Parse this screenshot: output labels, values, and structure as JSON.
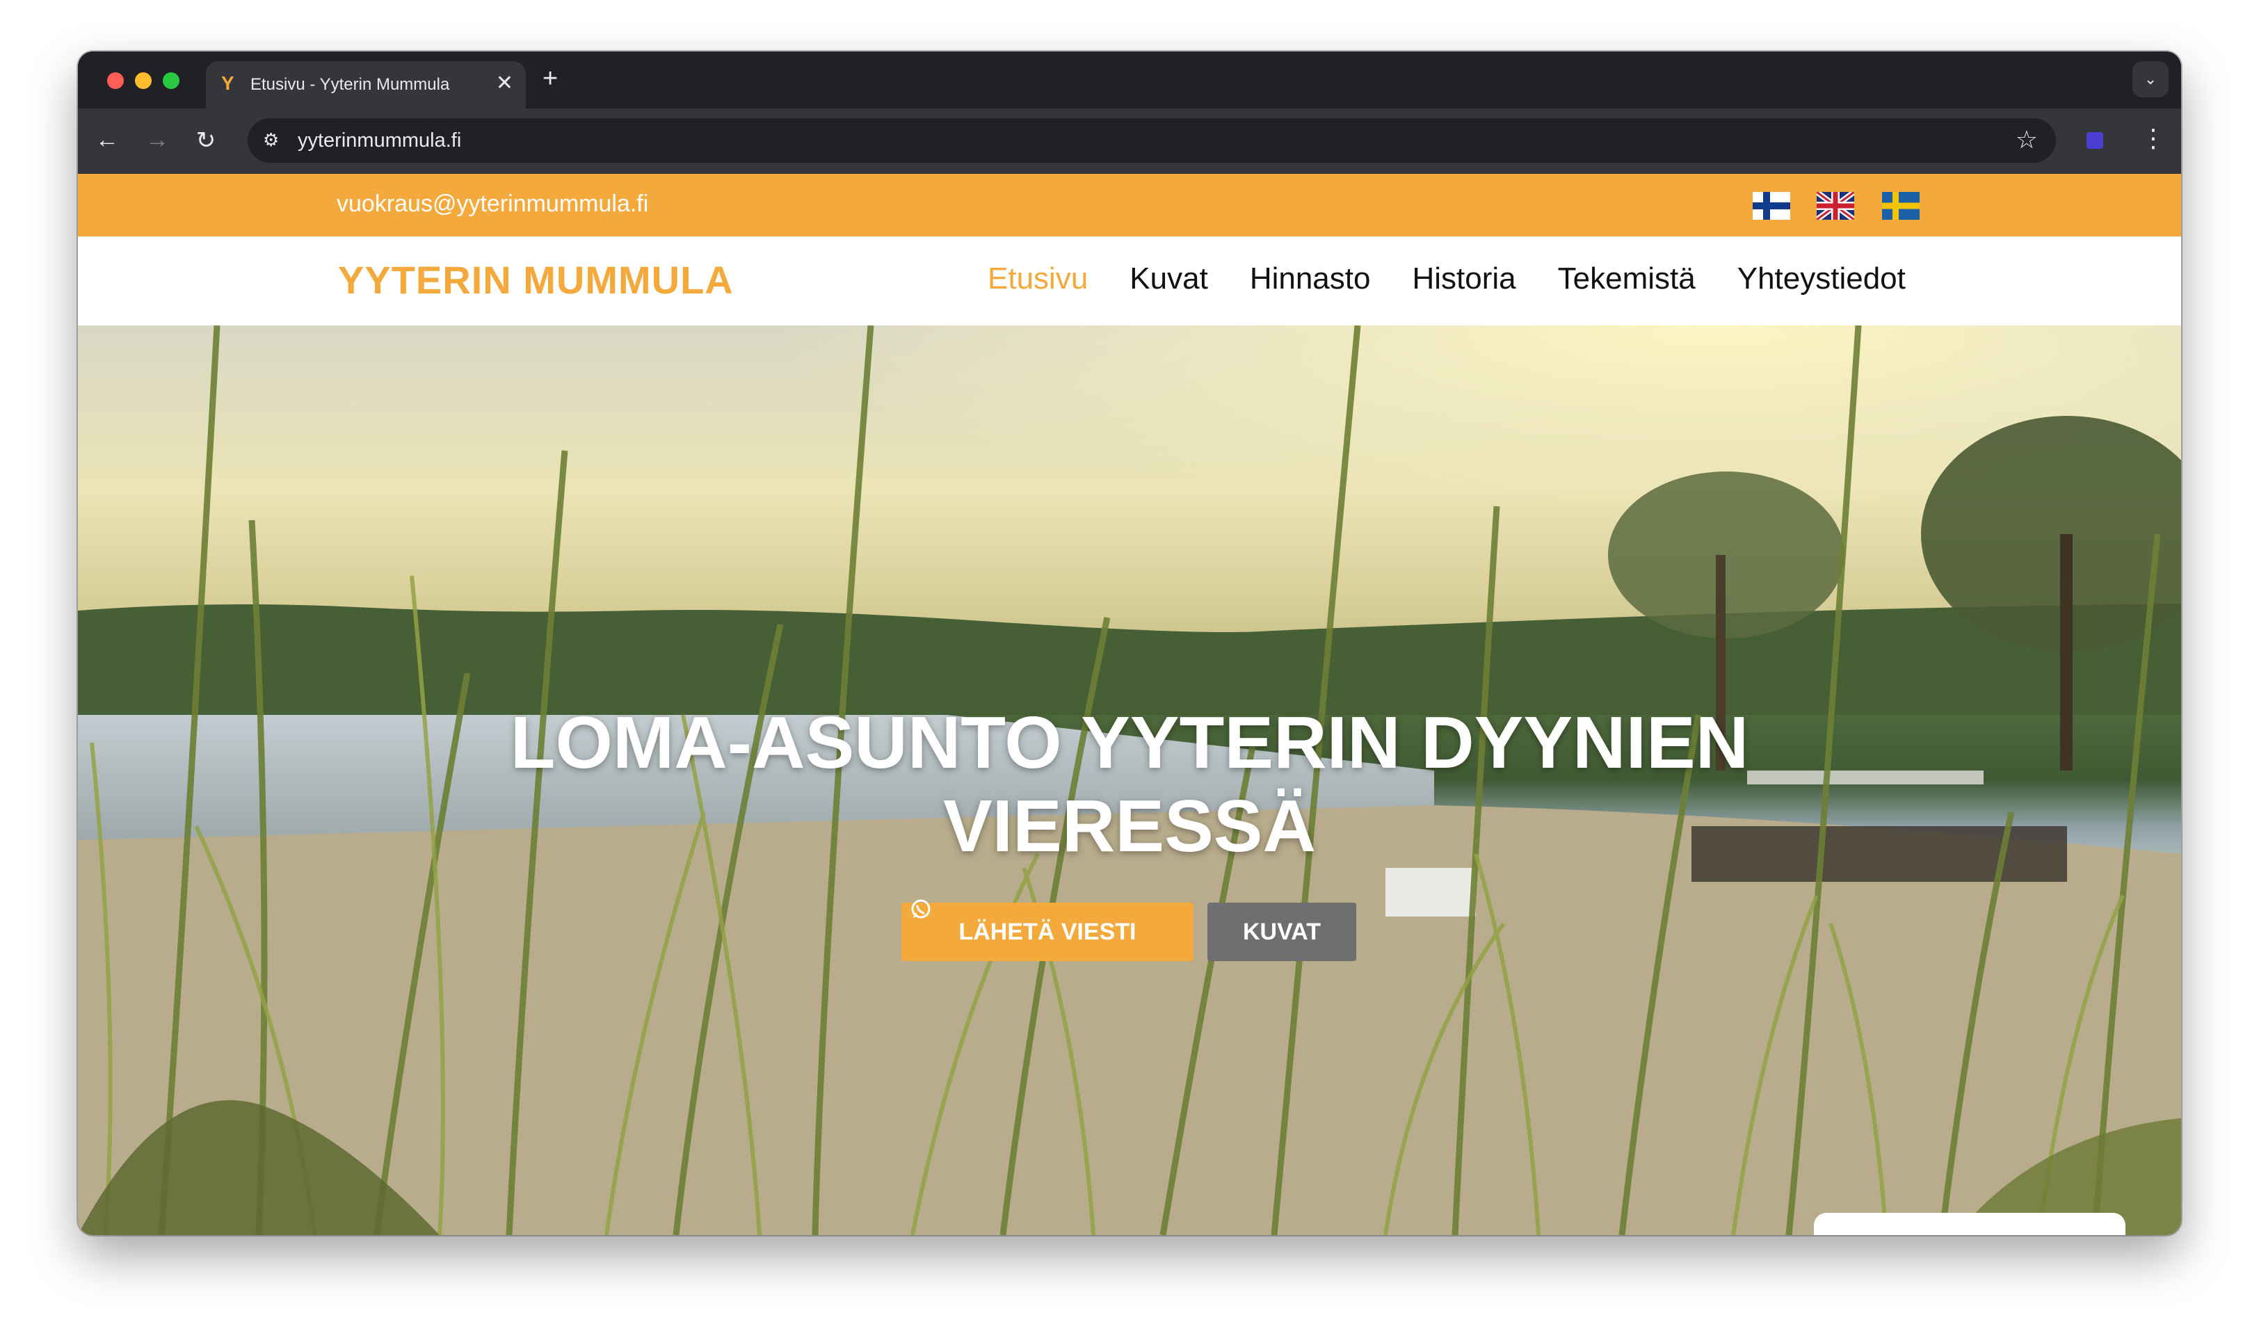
{
  "browser": {
    "tab_title": "Etusivu - Yyterin Mummula",
    "tab_favicon": "Y",
    "tab_close": "✕",
    "new_tab": "+",
    "url": "yyterinmummula.fi",
    "icons": {
      "back": "back-arrow-icon",
      "forward": "forward-arrow-icon",
      "reload": "reload-icon",
      "site_info": "tune-icon",
      "bookmark": "star-icon",
      "menu": "more-vert-icon",
      "tab_search": "chevron-down-icon"
    }
  },
  "site": {
    "email": "vuokraus@yyterinmummula.fi",
    "logo": "YYTERIN MUMMULA",
    "languages": [
      "fi",
      "en",
      "sv"
    ],
    "nav": [
      "Etusivu",
      "Kuvat",
      "Hinnasto",
      "Historia",
      "Tekemistä",
      "Yhteystiedot"
    ],
    "active_nav": "Etusivu",
    "hero": {
      "title_line1": "LOMA-ASUNTO YYTERIN DYYNIEN",
      "title_line2": "VIERESSÄ",
      "primary_button": "LÄHETÄ VIESTI",
      "secondary_button": "KUVAT"
    }
  },
  "colors": {
    "accent": "#f3a93b",
    "button_secondary": "#6f6f6f",
    "browser_dark": "#202124",
    "browser_toolbar": "#35363a"
  }
}
